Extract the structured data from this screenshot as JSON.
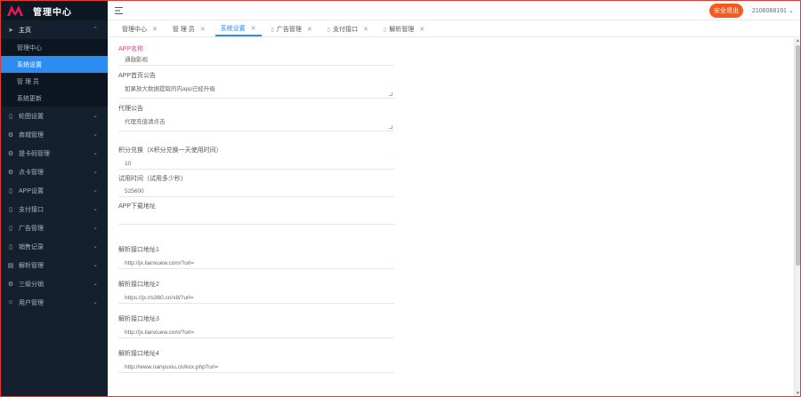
{
  "brand": {
    "title": "管理中心"
  },
  "sidebar": {
    "items": [
      {
        "label": "主页",
        "icon": "send-icon",
        "open": true,
        "children": [
          {
            "label": "管理中心",
            "active": false
          },
          {
            "label": "系统设置",
            "active": true
          },
          {
            "label": "管 理 员",
            "active": false
          },
          {
            "label": "系统更新",
            "active": false
          }
        ]
      },
      {
        "label": "轮图设置",
        "icon": "phone-icon"
      },
      {
        "label": "商城管理",
        "icon": "gear-icon"
      },
      {
        "label": "提卡码管理",
        "icon": "gear-icon"
      },
      {
        "label": "点卡管理",
        "icon": "gear-icon"
      },
      {
        "label": "APP设置",
        "icon": "tablet-icon"
      },
      {
        "label": "支付接口",
        "icon": "tablet-icon"
      },
      {
        "label": "广告管理",
        "icon": "tablet-icon"
      },
      {
        "label": "销售记录",
        "icon": "tablet-icon"
      },
      {
        "label": "解析管理",
        "icon": "chart-icon"
      },
      {
        "label": "三级分销",
        "icon": "gear-icon"
      },
      {
        "label": "用户管理",
        "icon": "user-icon"
      }
    ]
  },
  "header": {
    "signout_label": "安全退出",
    "user": "2106068191"
  },
  "tabs": [
    {
      "label": "管理中心",
      "active": false,
      "icon": false
    },
    {
      "label": "管 理 员",
      "active": false,
      "icon": false
    },
    {
      "label": "系统设置",
      "active": true,
      "icon": false
    },
    {
      "label": "广告管理",
      "active": false,
      "icon": true
    },
    {
      "label": "支付接口",
      "active": false,
      "icon": true
    },
    {
      "label": "解析管理",
      "active": false,
      "icon": true
    }
  ],
  "form": {
    "app_name_label": "APP名称",
    "app_name_value": "通融影视",
    "app_notice_label": "APP首页公告",
    "app_notice_value": "如果放大数据提取的内app已经升级",
    "agent_notice_label": "代理公告",
    "agent_notice_value": "代理充值请点击",
    "points_label": "积分兑换（X积分兑换一天使用时间）",
    "points_value": "10",
    "trial_label": "试用时间（试用多少秒）",
    "trial_value": "525600",
    "download_label": "APP下载地址",
    "download_value": "",
    "parse1_label": "解析接口地址1",
    "parse1_value": "http://jx.lianxuew.com/?url=",
    "parse2_label": "解析接口地址2",
    "parse2_value": "https://jx.rls360.cn/x8/?url=",
    "parse3_label": "解析接口地址3",
    "parse3_value": "http://jx.lianxuew.com/?url=",
    "parse4_label": "解析接口地址4",
    "parse4_value": "http://www.nanyuxiu.cn/kxx.php?url="
  },
  "colors": {
    "sidebar_bg": "#14202e",
    "accent": "#2d8cf0",
    "signout": "#f55a1e",
    "pink_label": "#e83e8c"
  }
}
